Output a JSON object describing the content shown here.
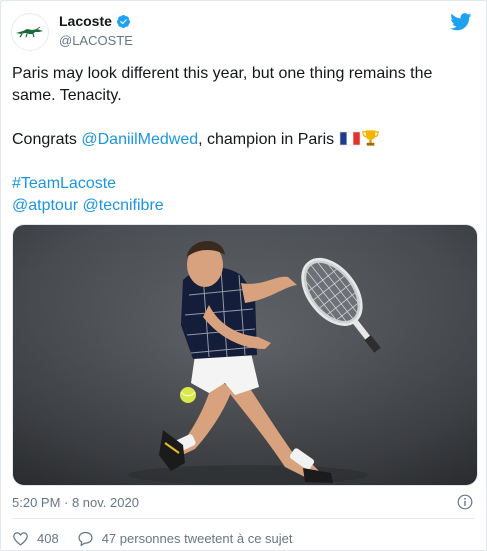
{
  "account": {
    "name": "Lacoste",
    "handle": "@LACOSTE",
    "verified": true,
    "avatar_icon": "lacoste-crocodile-logo",
    "brand_color": "#1b95e0"
  },
  "tweet": {
    "line1": "Paris may look different this year, but one thing remains the same. Tenacity.",
    "congrats_prefix": "Congrats ",
    "mention_medvedev": "@DaniilMedwed",
    "congrats_suffix": ", champion in Paris ",
    "hashtag": "#TeamLacoste",
    "mention_atp": "@atptour",
    "mention_tecnifibre": "@tecnifibre"
  },
  "media": {
    "subject": "tennis player hitting a backhand on a dark court"
  },
  "meta": {
    "timestamp": "5:20 PM · 8 nov. 2020"
  },
  "actions": {
    "likes": "408",
    "comments_label": "47 personnes tweetent à ce sujet"
  },
  "icons": {
    "bird": "twitter-bird-icon",
    "info": "info-icon",
    "heart": "heart-icon",
    "comment": "comment-icon",
    "flag": "france-flag-icon",
    "trophy": "trophy-icon"
  }
}
